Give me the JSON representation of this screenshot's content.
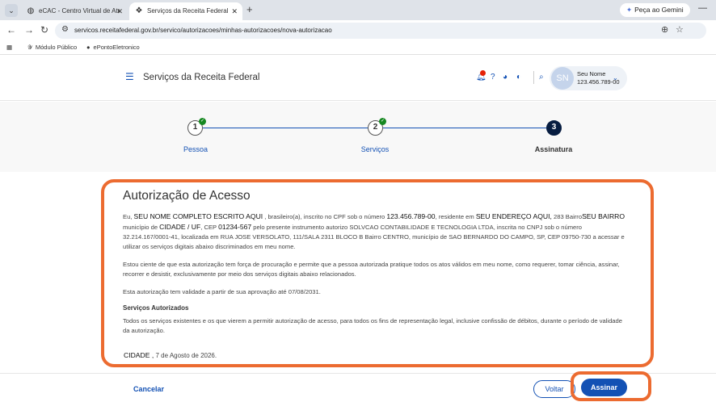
{
  "browser": {
    "tabs": [
      {
        "label": "eCAC - Centro Virtual de Atendimento",
        "active": false,
        "icon": "globe-icon"
      },
      {
        "label": "Serviços da Receita Federal",
        "active": true,
        "icon": "receita-icon"
      }
    ],
    "new_tab": "+",
    "gemini_label": "Peça ao Gemini",
    "url": "servicos.receitafederal.gov.br/servico/autorizacoes/minhas-autorizacoes/nova-autorizacao",
    "bookmarks": [
      {
        "label": "Módulo Público"
      },
      {
        "label": "ePontoEletronico"
      }
    ]
  },
  "header": {
    "title": "Serviços da Receita Federal",
    "user": {
      "initials": "SN",
      "name": "Seu Nome",
      "cpf": "123.456.789-00"
    }
  },
  "stepper": {
    "steps": [
      {
        "number": "1",
        "label": "Pessoa",
        "done": true
      },
      {
        "number": "2",
        "label": "Serviços",
        "done": true
      },
      {
        "number": "3",
        "label": "Assinatura",
        "done": false
      }
    ]
  },
  "authorization": {
    "title": "Autorização de Acesso",
    "p1": {
      "t1": "Eu, ",
      "name": "SEU NOME COMPLETO ESCRITO AQUI",
      "t2": " , brasileiro(a), inscrito no CPF sob o número ",
      "cpf": "123.456.789-00",
      "t3": ", residente em ",
      "address": "SEU ENDEREÇO AQUI,",
      "t4": " 283 Bairro",
      "bairro": "SEU BAIRRO",
      "t5": " município de ",
      "city": "CIDADE / UF",
      "t6": ", CEP ",
      "cep": "01234-567",
      "t7": " pelo presente instrumento autorizo SOLVCAO CONTABILIDADE E TECNOLOGIA LTDA, inscrita no CNPJ sob o número 32.214.167/0001-41, localizada em RUA JOSE VERSOLATO, 111/SALA 2311 BLOCO B Bairro CENTRO, município de SAO BERNARDO DO CAMPO, SP, CEP 09750-730 a acessar e utilizar os serviços digitais abaixo discriminados em meu nome."
    },
    "p2": "Estou ciente de que esta autorização tem força de procuração e permite que a pessoa autorizada pratique todos os atos válidos em meu nome, como requerer, tomar ciência, assinar, recorrer e desistir, exclusivamente por meio dos serviços digitais abaixo relacionados.",
    "p3": "Esta autorização tem validade a partir de sua aprovação até 07/08/2031.",
    "services_title": "Serviços Autorizados",
    "services_text": "Todos os serviços existentes e os que vierem a permitir autorização de acesso, para todos os fins de representação legal, inclusive confissão de débitos, durante o período de validade da autorização.",
    "signature_city": "CIDADE ,",
    "signature_date": " 7 de Agosto de 2026."
  },
  "actions": {
    "cancel": "Cancelar",
    "back": "Voltar",
    "sign": "Assinar"
  },
  "colors": {
    "primary": "#1351b4",
    "highlight": "#ec6b30",
    "success": "#168821",
    "current_step": "#071d41"
  }
}
